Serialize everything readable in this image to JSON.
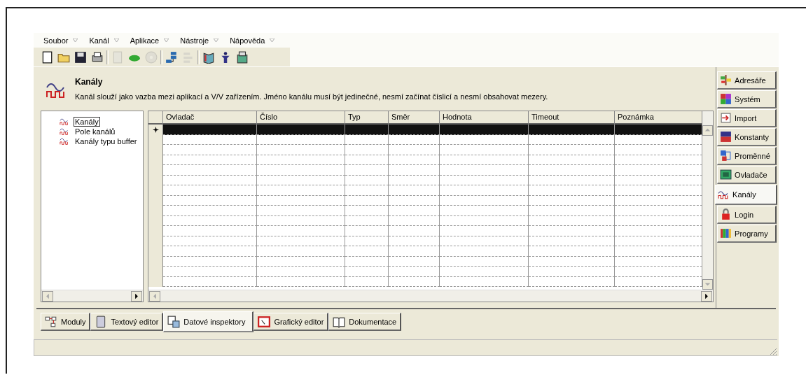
{
  "menu": [
    {
      "label": "Soubor"
    },
    {
      "label": "Kanál"
    },
    {
      "label": "Aplikace"
    },
    {
      "label": "Nástroje"
    },
    {
      "label": "Nápověda"
    }
  ],
  "toolbar": [
    [
      {
        "disabled": false
      },
      {
        "disabled": false
      },
      {
        "disabled": false
      },
      {
        "disabled": false
      }
    ],
    [
      {
        "disabled": true
      },
      {
        "disabled": false
      },
      {
        "disabled": true
      }
    ],
    [
      {
        "disabled": false
      },
      {
        "disabled": true
      }
    ],
    [
      {
        "disabled": false
      },
      {
        "disabled": false
      },
      {
        "disabled": false
      }
    ]
  ],
  "header": {
    "title": "Kanály",
    "description": "Kanál slouží jako vazba mezi aplikací a V/V zařízením. Jméno kanálu musí být jedinečné, nesmí začínat číslicí a nesmí obsahovat mezery."
  },
  "tree": [
    {
      "label": "Kanály",
      "selected": true
    },
    {
      "label": "Pole kanálů",
      "selected": false
    },
    {
      "label": "Kanály typu buffer",
      "selected": false
    }
  ],
  "table": {
    "columns": [
      "Ovladač",
      "Číslo",
      "Typ",
      "Směr",
      "Hodnota",
      "Timeout",
      "Poznámka"
    ],
    "rows": [
      {
        "selected": true
      },
      {
        "selected": false
      },
      {
        "selected": false
      },
      {
        "selected": false
      },
      {
        "selected": false
      },
      {
        "selected": false
      },
      {
        "selected": false
      },
      {
        "selected": false
      },
      {
        "selected": false
      },
      {
        "selected": false
      },
      {
        "selected": false
      },
      {
        "selected": false
      },
      {
        "selected": false
      },
      {
        "selected": false
      },
      {
        "selected": false
      },
      {
        "selected": false
      }
    ]
  },
  "side_tabs": [
    {
      "label": "Adresáře",
      "selected": false
    },
    {
      "label": "Systém",
      "selected": false
    },
    {
      "label": "Import",
      "selected": false
    },
    {
      "label": "Konstanty",
      "selected": false
    },
    {
      "label": "Proměnné",
      "selected": false
    },
    {
      "label": "Ovladače",
      "selected": false
    },
    {
      "label": "Kanály",
      "selected": true
    },
    {
      "label": "Login",
      "selected": false
    },
    {
      "label": "Programy",
      "selected": false
    }
  ],
  "bottom_tabs": [
    {
      "label": "Moduly",
      "selected": false
    },
    {
      "label": "Textový editor",
      "selected": false
    },
    {
      "label": "Datové inspektory",
      "selected": true
    },
    {
      "label": "Grafický editor",
      "selected": false
    },
    {
      "label": "Dokumentace",
      "selected": false
    }
  ]
}
